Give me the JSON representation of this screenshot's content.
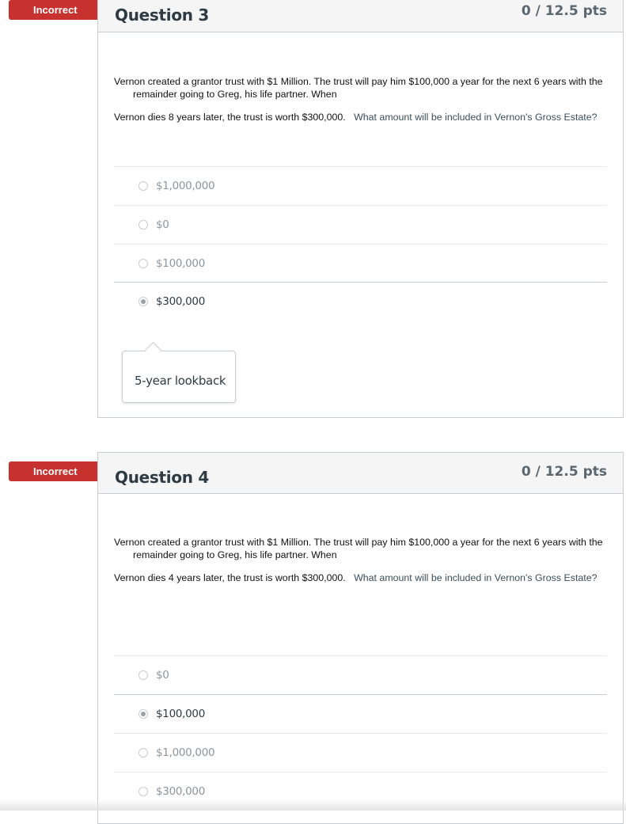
{
  "questions": [
    {
      "status": "Incorrect",
      "title": "Question 3",
      "points": "0 / 12.5 pts",
      "text_line1": "Vernon created a grantor trust with $1 Million.  The trust will pay him $100,000 a year for the next 6 years with the remainder going to Greg, his life partner.  When",
      "text_line2_a": "Vernon dies 8 years later, the trust is worth $300,000.",
      "text_line2_b": "What amount will be included in Vernon's Gross Estate?",
      "answers": [
        "$1,000,000",
        "$0",
        "$100,000",
        "$300,000"
      ],
      "selected_index": 3,
      "comment": "5-year lookback"
    },
    {
      "status": "Incorrect",
      "title": "Question 4",
      "points": "0 / 12.5 pts",
      "text_line1": "Vernon created a grantor trust with $1 Million.  The trust will pay him $100,000 a year for the next 6 years with the remainder going to Greg, his life partner.  When",
      "text_line2_a": "Vernon dies 4 years later, the trust is worth $300,000.",
      "text_line2_b": "What amount will be included in Vernon's Gross Estate?",
      "answers": [
        "$0",
        "$100,000",
        "$1,000,000",
        "$300,000"
      ],
      "selected_index": 1
    }
  ],
  "colors": {
    "incorrect_badge": "#c7322e",
    "header_bg": "#f5f5f5",
    "border": "#c7cdd1"
  }
}
